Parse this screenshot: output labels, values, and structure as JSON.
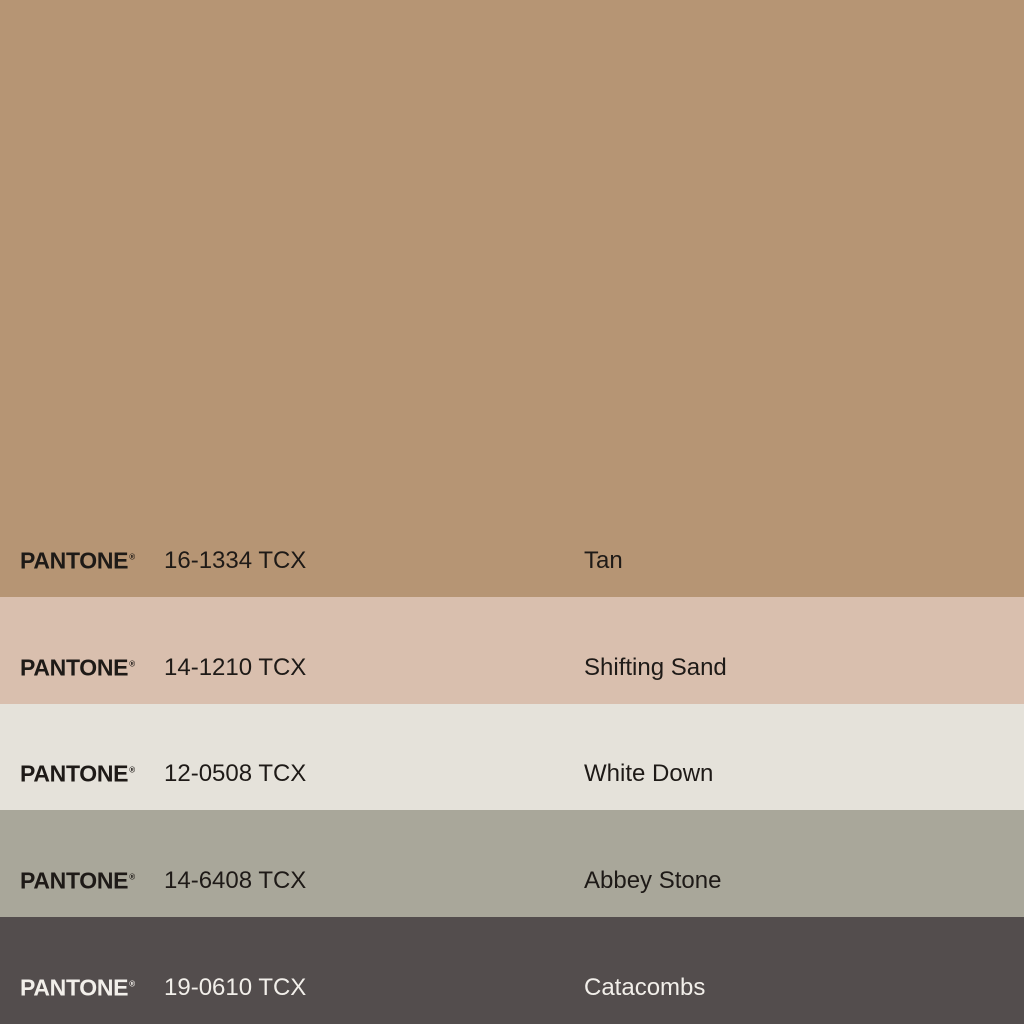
{
  "swatches": [
    {
      "brand": "PANTONE",
      "mark": "®",
      "code": "16-1334 TCX",
      "name": "Tan",
      "color": "#B69574",
      "text_color": "#1E1A17"
    },
    {
      "brand": "PANTONE",
      "mark": "®",
      "code": "14-1210 TCX",
      "name": "Shifting Sand",
      "color": "#D9BFAE",
      "text_color": "#1E1A17"
    },
    {
      "brand": "PANTONE",
      "mark": "®",
      "code": "12-0508 TCX",
      "name": "White Down",
      "color": "#E5E2DA",
      "text_color": "#1E1A17"
    },
    {
      "brand": "PANTONE",
      "mark": "®",
      "code": "14-6408 TCX",
      "name": "Abbey Stone",
      "color": "#A9A79A",
      "text_color": "#1E1A17"
    },
    {
      "brand": "PANTONE",
      "mark": "®",
      "code": "19-0610 TCX",
      "name": "Catacombs",
      "color": "#534D4D",
      "text_color": "#F2EFEA"
    }
  ]
}
